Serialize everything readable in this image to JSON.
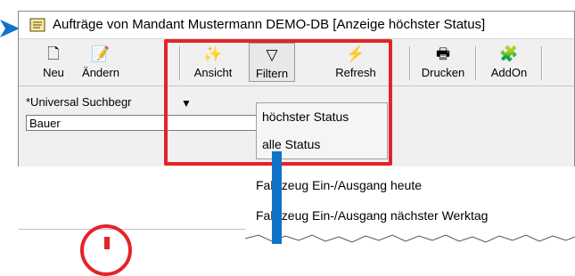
{
  "window": {
    "title": "Aufträge von Mandant  Mustermann DEMO-DB [Anzeige höchster Status]"
  },
  "toolbar": {
    "buttons": [
      {
        "label": "Neu",
        "icon": "new-document-icon",
        "glyph": "🗋"
      },
      {
        "label": "Ändern",
        "icon": "edit-icon",
        "glyph": "📝"
      },
      {
        "label": "Ansicht",
        "icon": "view-icon",
        "glyph": "✨"
      },
      {
        "label": "Filtern",
        "icon": "filter-icon",
        "glyph": "▽"
      },
      {
        "label": "Refresh",
        "icon": "refresh-icon",
        "glyph": "⚡"
      },
      {
        "label": "Drucken",
        "icon": "printer-icon",
        "glyph": "🖶"
      },
      {
        "label": "AddOn",
        "icon": "addon-icon",
        "glyph": "🧩"
      }
    ]
  },
  "search": {
    "label": "*Universal Suchbegr",
    "value": "Bauer"
  },
  "filter_menu": {
    "items": [
      "höchster Status",
      "alle Status"
    ]
  },
  "submenu": {
    "items": [
      "Fahrzeug Ein-/Ausgang heute",
      "Fahrzeug Ein-/Ausgang nächster Werktag"
    ]
  },
  "colors": {
    "highlight": "#e52328",
    "accent_blue": "#1172c9"
  }
}
